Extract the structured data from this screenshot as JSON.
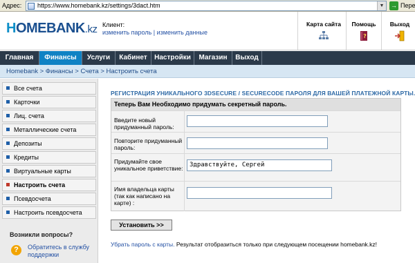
{
  "browser": {
    "address_label": "Адрес:",
    "url": "https://www.homebank.kz/settings/3dact.htm",
    "go_label": "Пере"
  },
  "header": {
    "logo_h": "H",
    "logo_rest": "OMEBANK",
    "logo_kz": ".kz",
    "client_label": "Клиент:",
    "change_password": "изменить пароль",
    "link_sep": " | ",
    "change_data": "изменить данные",
    "sitemap": "Карта сайта",
    "help": "Помощь",
    "logout": "Выход"
  },
  "nav": {
    "tabs": [
      "Главная",
      "Финансы",
      "Услуги",
      "Кабинет",
      "Настройки",
      "Магазин",
      "Выход"
    ],
    "active_index": 1
  },
  "breadcrumb": {
    "items": [
      "Homebank",
      "Финансы",
      "Счета",
      "Настроить счета"
    ],
    "separator": " > "
  },
  "sidebar": {
    "items": [
      "Все счета",
      "Карточки",
      "Лиц. счета",
      "Металлические счета",
      "Депозиты",
      "Кредиты",
      "Виртуальные карты",
      "Настроить счета",
      "Псевдосчета",
      "Настроить псевдосчета"
    ],
    "active_index": 7,
    "questions_title": "Возникли вопросы?",
    "support_link": "Обратитесь в службу поддержки"
  },
  "main": {
    "title": "РЕГИСТРАЦИЯ УНИКАЛЬНОГО 3DSECURE / SECURECODE ПАРОЛЯ ДЛЯ ВАШЕЙ ПЛАТЕЖНОЙ КАРТЫ.",
    "form_head": "Теперь Вам Необходимо придумать секретный пароль.",
    "new_password_label": "Введите новый придуманный пароль:",
    "new_password_value": "",
    "repeat_password_label": "Повторите придуманный пароль:",
    "repeat_password_value": "",
    "greeting_label": "Придумайте свое уникальное приветствие:",
    "greeting_value": "Здравствуйте, Сергей",
    "cardholder_label": "Имя владельца карты (так как написано на карте) :",
    "cardholder_value": "",
    "submit_label": "Установить >>",
    "remove_link": "Убрать пароль с карты.",
    "result_text": " Результат отобразиться только при следующем посещении homebank.kz!"
  }
}
